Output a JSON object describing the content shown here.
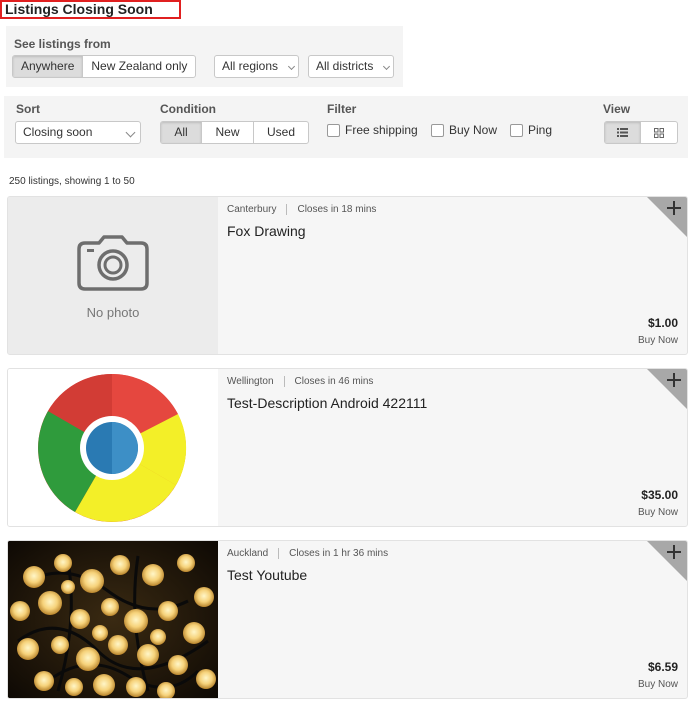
{
  "page": {
    "title": "Listings Closing Soon"
  },
  "location": {
    "label": "See listings from",
    "options": [
      "Anywhere",
      "New Zealand only"
    ],
    "active_option": "Anywhere",
    "regions": "All regions",
    "districts": "All districts"
  },
  "filters": {
    "sort_label": "Sort",
    "sort_value": "Closing soon",
    "condition_label": "Condition",
    "condition_options": [
      "All",
      "New",
      "Used"
    ],
    "condition_active": "All",
    "filter_label": "Filter",
    "checkboxes": [
      "Free shipping",
      "Buy Now",
      "Ping"
    ],
    "view_label": "View",
    "view_modes": [
      "list-view-icon",
      "grid-view-icon"
    ],
    "view_active": "list"
  },
  "results": {
    "summary": "250 listings, showing 1 to 50"
  },
  "listings": [
    {
      "location": "Canterbury",
      "closes": "Closes in 18 mins",
      "title": "Fox Drawing",
      "price": "$1.00",
      "price_type": "Buy Now",
      "image": "camera-icon",
      "no_photo_text": "No photo"
    },
    {
      "location": "Wellington",
      "closes": "Closes in 46 mins",
      "title": "Test-Description Android 422111",
      "price": "$35.00",
      "price_type": "Buy Now",
      "image": "chrome-logo"
    },
    {
      "location": "Auckland",
      "closes": "Closes in 1 hr 36 mins",
      "title": "Test Youtube",
      "price": "$6.59",
      "price_type": "Buy Now",
      "image": "string-lights-photo"
    }
  ],
  "colors": {
    "accent_red": "#e02020",
    "panel_bg": "#f4f4f4",
    "card_bg": "#f6f6f6",
    "corner_grey": "#a8a8a8"
  }
}
